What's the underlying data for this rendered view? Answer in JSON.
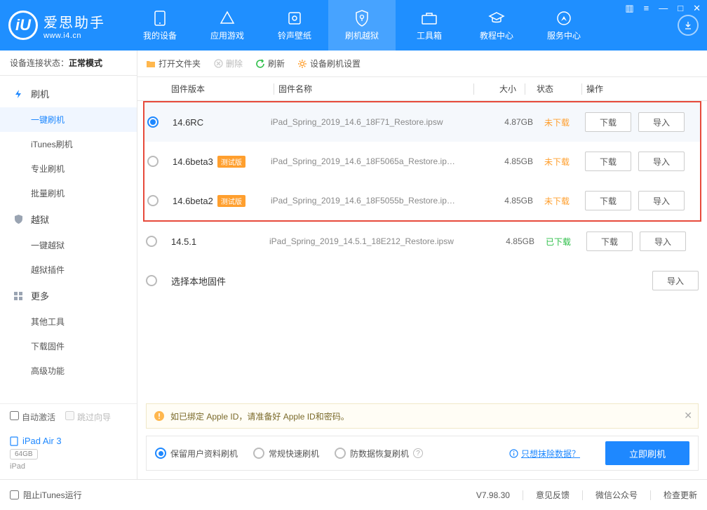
{
  "app": {
    "name": "爱思助手",
    "url": "www.i4.cn"
  },
  "nav": [
    {
      "label": "我的设备"
    },
    {
      "label": "应用游戏"
    },
    {
      "label": "铃声壁纸"
    },
    {
      "label": "刷机越狱"
    },
    {
      "label": "工具箱"
    },
    {
      "label": "教程中心"
    },
    {
      "label": "服务中心"
    }
  ],
  "conn": {
    "label": "设备连接状态：",
    "value": "正常模式"
  },
  "sidebar": {
    "g1": {
      "title": "刷机",
      "items": [
        "一键刷机",
        "iTunes刷机",
        "专业刷机",
        "批量刷机"
      ]
    },
    "g2": {
      "title": "越狱",
      "items": [
        "一键越狱",
        "越狱插件"
      ]
    },
    "g3": {
      "title": "更多",
      "items": [
        "其他工具",
        "下载固件",
        "高级功能"
      ]
    }
  },
  "bottom": {
    "auto_activate": "自动激活",
    "skip_guide": "跳过向导",
    "device_name": "iPad Air 3",
    "capacity": "64GB",
    "device_type": "iPad"
  },
  "toolbar": {
    "open_folder": "打开文件夹",
    "delete": "删除",
    "refresh": "刷新",
    "settings": "设备刷机设置"
  },
  "thead": {
    "ver": "固件版本",
    "name": "固件名称",
    "size": "大小",
    "status": "状态",
    "ops": "操作"
  },
  "rows": [
    {
      "ver": "14.6RC",
      "beta": "",
      "name": "iPad_Spring_2019_14.6_18F71_Restore.ipsw",
      "size": "4.87GB",
      "status": "未下载",
      "done": false,
      "sel": true
    },
    {
      "ver": "14.6beta3",
      "beta": "测试版",
      "name": "iPad_Spring_2019_14.6_18F5065a_Restore.ip…",
      "size": "4.85GB",
      "status": "未下载",
      "done": false,
      "sel": false
    },
    {
      "ver": "14.6beta2",
      "beta": "测试版",
      "name": "iPad_Spring_2019_14.6_18F5055b_Restore.ip…",
      "size": "4.85GB",
      "status": "未下载",
      "done": false,
      "sel": false
    },
    {
      "ver": "14.5.1",
      "beta": "",
      "name": "iPad_Spring_2019_14.5.1_18E212_Restore.ipsw",
      "size": "4.85GB",
      "status": "已下载",
      "done": true,
      "sel": false
    }
  ],
  "local_row": "选择本地固件",
  "btn": {
    "download": "下载",
    "import": "导入"
  },
  "notice": "如已绑定 Apple ID，请准备好 Apple ID和密码。",
  "modes": {
    "keep": "保留用户资料刷机",
    "fast": "常规快速刷机",
    "antir": "防数据恢复刷机",
    "link": "只想抹除数据？",
    "go": "立即刷机"
  },
  "footer": {
    "block_itunes": "阻止iTunes运行",
    "version": "V7.98.30",
    "feedback": "意见反馈",
    "wechat": "微信公众号",
    "update": "检查更新"
  }
}
